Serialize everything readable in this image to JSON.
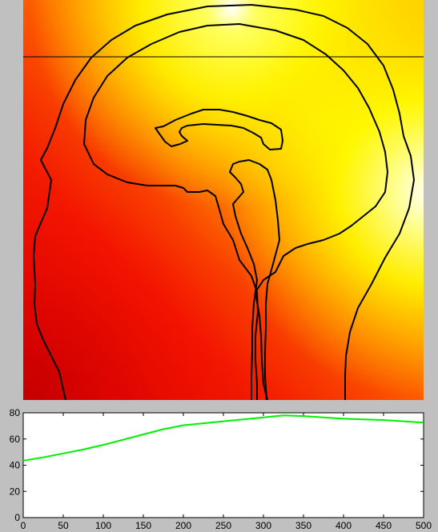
{
  "colors": {
    "background": "#c0c0c0",
    "heat_low": "#d40000",
    "heat_mid": "#ff8c00",
    "heat_high": "#ffff00",
    "heat_peak": "#ffffff",
    "contour": "#000000",
    "profile_line": "#00ee00",
    "plot_bg": "#ffffff"
  },
  "heatmap": {
    "type": "heatmap",
    "colormap": "hot",
    "overlay": "head-contour",
    "scanline": "horizontal"
  },
  "chart_data": {
    "type": "line",
    "title": "",
    "xlabel": "",
    "ylabel": "",
    "xlim": [
      0,
      500
    ],
    "ylim": [
      0,
      80
    ],
    "grid": false,
    "x_ticks": [
      "0",
      "50",
      "100",
      "150",
      "200",
      "250",
      "300",
      "350",
      "400",
      "450",
      "500"
    ],
    "y_ticks": [
      "0",
      "20",
      "40",
      "60",
      "80"
    ],
    "series": [
      {
        "x": [
          0,
          25,
          50,
          75,
          100,
          125,
          150,
          175,
          200,
          225,
          250,
          275,
          300,
          325,
          350,
          375,
          400,
          425,
          450,
          475,
          500
        ],
        "y": [
          43.5,
          46,
          49,
          52,
          55.5,
          59.5,
          63.5,
          67.5,
          70.5,
          72,
          73.5,
          75,
          76.5,
          78,
          77.5,
          76.5,
          75.5,
          75,
          74.5,
          73.5,
          72.5
        ]
      }
    ]
  }
}
